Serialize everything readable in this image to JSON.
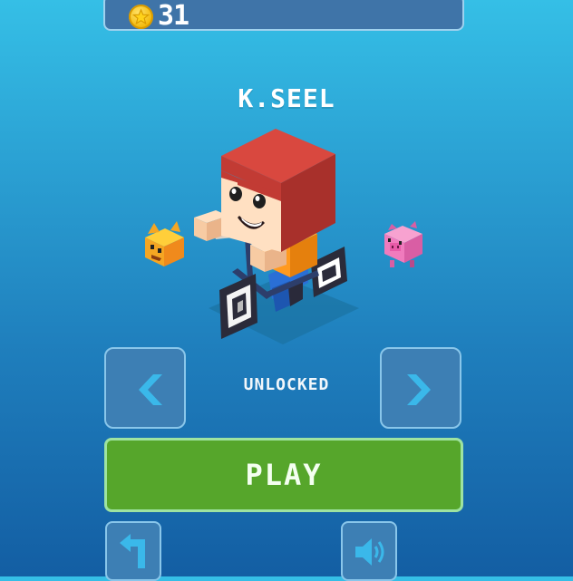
{
  "hud": {
    "coin_count": "31",
    "coin_icon": "star-coin-icon"
  },
  "character": {
    "name": "K.SEEL",
    "status": "UNLOCKED",
    "prev_character_icon": "orange-cat-icon",
    "next_character_icon": "pink-pig-icon"
  },
  "controls": {
    "play_label": "PLAY",
    "prev_icon": "chevron-left-icon",
    "next_icon": "chevron-right-icon",
    "back_icon": "back-arrow-icon",
    "sound_icon": "speaker-icon"
  },
  "colors": {
    "play_button": "#56a62b",
    "panel": "#3d7fb4",
    "coin": "#f2b705"
  }
}
